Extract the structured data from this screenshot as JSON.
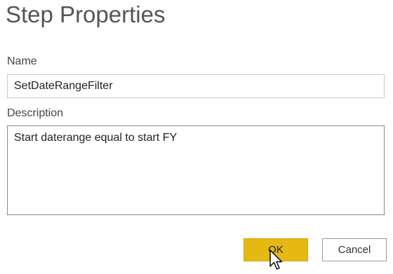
{
  "dialog": {
    "title": "Step Properties",
    "name_label": "Name",
    "name_value": "SetDateRangeFilter",
    "description_label": "Description",
    "description_value": "Start daterange equal to start FY",
    "ok_label": "OK",
    "cancel_label": "Cancel"
  },
  "colors": {
    "ok_button": "#e5b814",
    "cancel_border": "#9a9a9a",
    "input_border": "#c8c8c8"
  },
  "icons": {
    "cursor": "mouse-pointer-icon"
  }
}
